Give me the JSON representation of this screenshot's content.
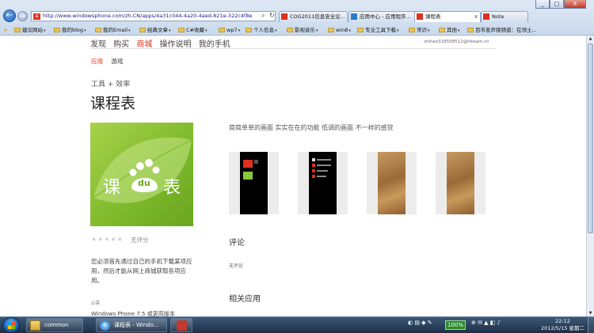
{
  "browser": {
    "window_buttons": [
      "_",
      "□",
      "X"
    ],
    "url": "http://www.windowsphone.com/zh-CN/apps/4a31c044-4a20-4aed-821e-322c4f8e",
    "tabs": [
      {
        "label": "COG2011信息安全论...",
        "active": false
      },
      {
        "label": "应用中心 - 应用程序...",
        "active": false
      },
      {
        "label": "课程表",
        "active": true
      },
      {
        "label": "Note",
        "active": false
      }
    ],
    "tab_close": "x",
    "favorites": [
      "建议网站",
      "我的blog",
      "我的Email",
      "经典文章",
      "C#收藏",
      "wp7",
      "个人信息",
      "影视音乐",
      "win8",
      "专业工具下载",
      "常识",
      "其他",
      "百市发声银频道：在领土..."
    ]
  },
  "page": {
    "top_nav": [
      "发现",
      "购买",
      "商城",
      "操作说明",
      "我的手机"
    ],
    "top_nav_selected": "商城",
    "account_email": "shihao316558512@hiteam.cn",
    "sub_nav": [
      "应用",
      "游戏"
    ],
    "breadcrumb": "工具 + 效率",
    "title": "课程表",
    "app_icon_text": {
      "left": "课",
      "middle": "du",
      "right": "表"
    },
    "rating_stars": "★★★★★",
    "rating_value": 0,
    "rating_text": "无评分",
    "install_notice": "您必须首先通过自己的手机下载某项应用，然后才能从网上商城获取各项应用。",
    "requirements_label": "必需",
    "requirements_text": "Windows Phone 7.5 或更高版本",
    "tagline": "简简单单的画面  实实在在的功能  低调的画面  不一样的感觉",
    "reviews_heading": "评论",
    "reviews_text": "无评论",
    "related_heading": "相关应用"
  },
  "taskbar": {
    "items": [
      {
        "label": "common",
        "icon": "folder-icon"
      },
      {
        "label": "课程表 - Windo...",
        "icon": "ie-icon"
      },
      {
        "label": "",
        "icon": "app-icon"
      }
    ],
    "battery": "100%",
    "time": "22:12",
    "date": "2012/5/15 星期二"
  },
  "colors": {
    "accent": "#e0301e",
    "icon_green": "#7cb82a"
  }
}
